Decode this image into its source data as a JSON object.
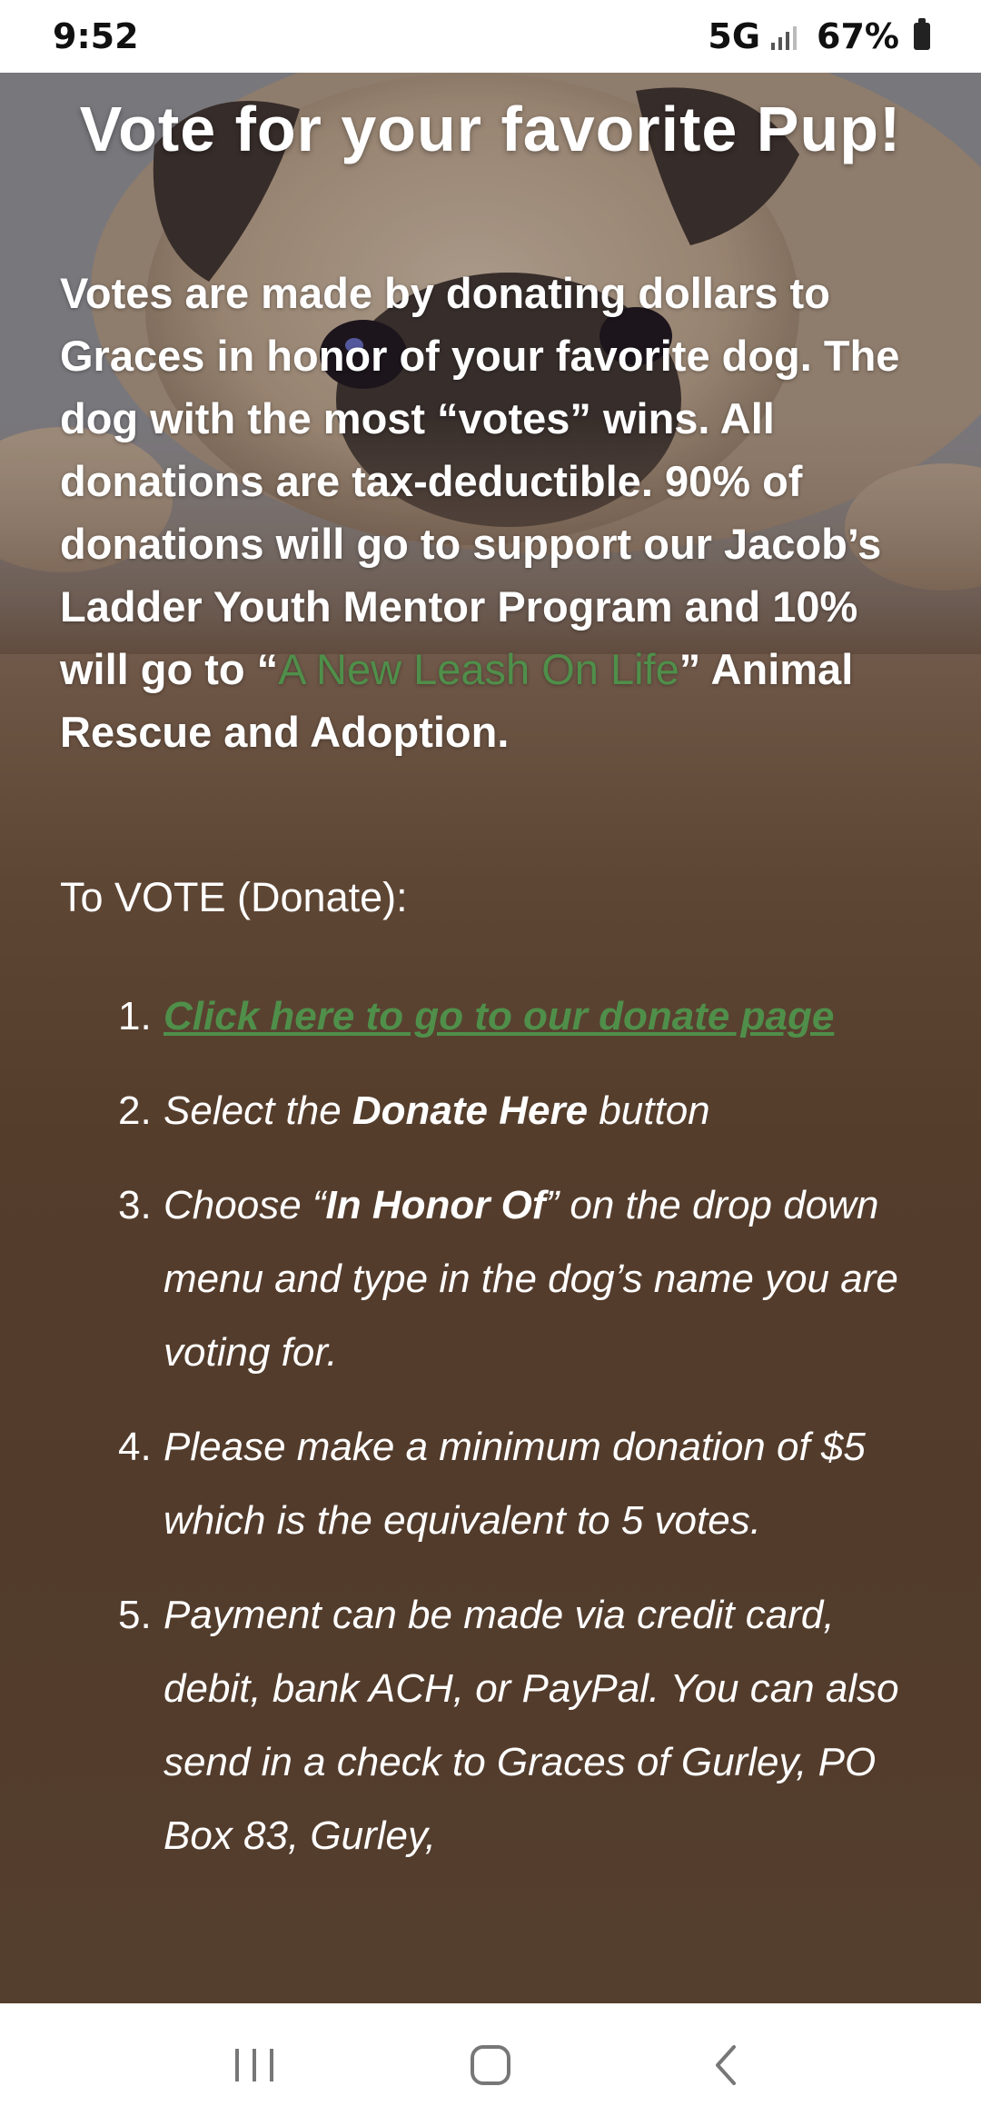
{
  "status": {
    "time": "9:52",
    "network": "5G",
    "battery": "67%"
  },
  "page": {
    "title": "Vote for your favorite Pup!",
    "intro_part1": "Votes are made by donating dollars to Graces in honor of your favorite dog. The dog with the most “votes” wins. All donations are tax-deductible. 90% of donations will go to support our Jacob’s Ladder Youth Mentor Program and 10% will go to “",
    "intro_link": "A New Leash On Life",
    "intro_part2": "” Animal Rescue and Adoption.",
    "vote_heading": "To VOTE (Donate):",
    "steps": [
      {
        "num": "1.",
        "link": "Click here to go to our donate page"
      },
      {
        "num": "2.",
        "pre": "Select the ",
        "bold": "Donate Here",
        "post": " button"
      },
      {
        "num": "3.",
        "pre": "Choose “",
        "bold": "In Honor Of",
        "post": "” on the drop down menu and type in the dog’s name you are voting for."
      },
      {
        "num": "4.",
        "text": "Please make a minimum donation of $5 which is the equivalent to 5 votes."
      },
      {
        "num": "5.",
        "text": "Payment can be made via credit card, debit, bank ACH, or PayPal. You can also send in a check to Graces of Gurley, PO Box 83, Gurley,"
      }
    ]
  },
  "colors": {
    "link_green": "#4f8f4a",
    "text": "#ffffff",
    "background_brown": "#523b2b"
  },
  "icons": {
    "nav_recents": "recent-apps-icon",
    "nav_home": "home-icon",
    "nav_back": "back-icon",
    "background": "pug-photo"
  }
}
